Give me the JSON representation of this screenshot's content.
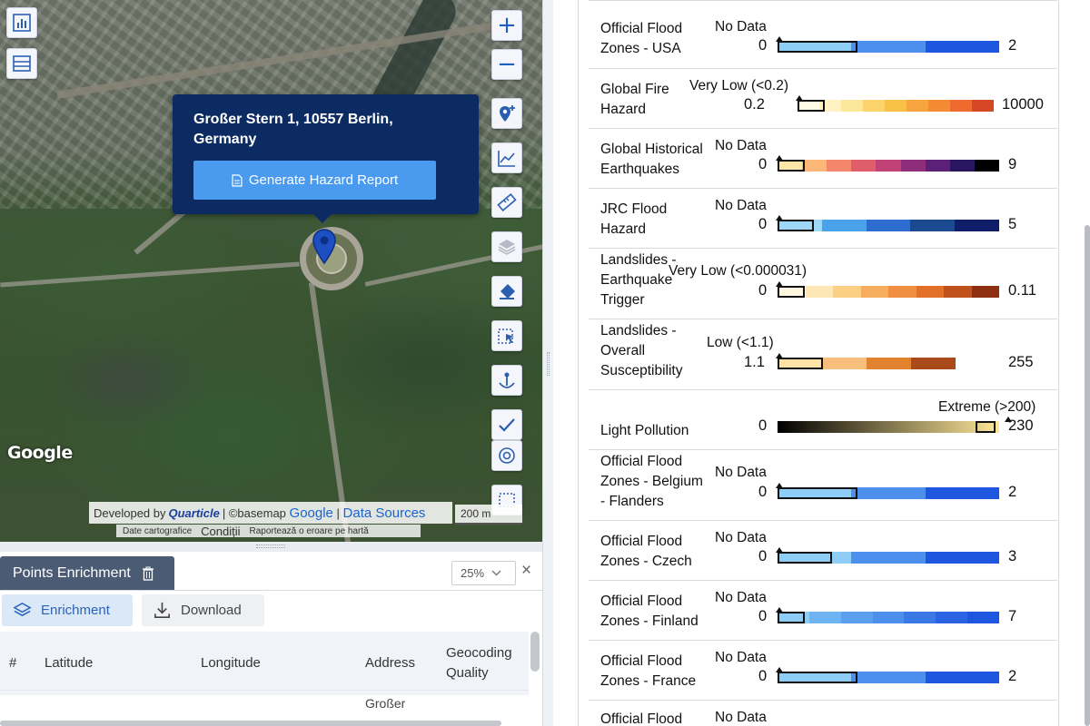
{
  "map": {
    "popup": {
      "address": "Großer Stern 1, 10557 Berlin, Germany",
      "button_label": "Generate Hazard Report"
    },
    "zoom_in": "+",
    "zoom_out": "−",
    "google_logo": "Google",
    "attribution": {
      "developed_by": "Developed by",
      "brand": "Quarticle",
      "basemap": "| ©basemap",
      "google": "Google",
      "sep": "|",
      "data_sources": "Data Sources"
    },
    "scale": "200 m",
    "terms": [
      "Date cartografice",
      "Condiții",
      "Raportează o eroare pe hartă"
    ],
    "tools": [
      "chart-panel-icon",
      "list-panel-icon",
      "add-location-icon",
      "line-chart-icon",
      "ruler-icon",
      "layers-icon",
      "eraser-icon",
      "select-area-icon",
      "anchor-icon",
      "check-icon",
      "target-icon",
      "draw-rect-icon"
    ]
  },
  "bottom_panel": {
    "tab_title": "Points Enrichment",
    "zoom_select": "25%",
    "close": "×",
    "enrichment_label": "Enrichment",
    "download_label": "Download",
    "columns": [
      "#",
      "Latitude",
      "Longitude",
      "Address",
      "Geocoding",
      "Quality"
    ],
    "first_row_address": "Großer"
  },
  "legend": [
    {
      "name": [
        "Official Flood",
        "Zones - USA"
      ],
      "value": "No Data",
      "min": "0",
      "max": "2"
    },
    {
      "name": [
        "Global Fire",
        "Hazard"
      ],
      "value": "Very Low (<0.2)",
      "min": "0.2",
      "max": "10000"
    },
    {
      "name": [
        "Global Historical",
        "Earthquakes"
      ],
      "value": "No Data",
      "min": "0",
      "max": "9"
    },
    {
      "name": [
        "JRC Flood",
        "Hazard"
      ],
      "value": "No Data",
      "min": "0",
      "max": "5"
    },
    {
      "name": [
        "Landslides -",
        "Earthquake",
        "Trigger"
      ],
      "value": "Very Low (<0.000031)",
      "min": "0",
      "max": "0.11"
    },
    {
      "name": [
        "Landslides -",
        "Overall",
        "Susceptibility"
      ],
      "value": "Low (<1.1)",
      "min": "1.1",
      "max": "255"
    },
    {
      "name": [
        "Light Pollution"
      ],
      "value": "Extreme (>200)",
      "min": "0",
      "max": "230"
    },
    {
      "name": [
        "Official Flood",
        "Zones - Belgium",
        "- Flanders"
      ],
      "value": "No Data",
      "min": "0",
      "max": "2"
    },
    {
      "name": [
        "Official Flood",
        "Zones - Czech"
      ],
      "value": "No Data",
      "min": "0",
      "max": "3"
    },
    {
      "name": [
        "Official Flood",
        "Zones - Finland"
      ],
      "value": "No Data",
      "min": "0",
      "max": "7"
    },
    {
      "name": [
        "Official Flood",
        "Zones - France"
      ],
      "value": "No Data",
      "min": "0",
      "max": "2"
    },
    {
      "name": [
        "Official Flood"
      ],
      "value": "No Data",
      "min": "",
      "max": ""
    }
  ],
  "colors": {
    "popup_bg": "#0c2b62",
    "button_blue": "#4a9aef",
    "tab_bg": "#4a5b73",
    "flood_scale": [
      "#8ecdf6",
      "#4c8fec",
      "#1e56e0"
    ],
    "fire_scale": [
      "#fffbe6",
      "#fff3c4",
      "#fde79a",
      "#fbd46b",
      "#f9c046",
      "#f6a43e",
      "#f48a33",
      "#ee6b2d",
      "#d64726"
    ],
    "quake_scale": [
      "#fde7a8",
      "#fcb779",
      "#f4866c",
      "#e05e6c",
      "#c04276",
      "#8e2d7a",
      "#5b2078",
      "#2a1660",
      "#000000"
    ],
    "jrc_scale": [
      "#9fd7f7",
      "#4aa3ea",
      "#2d6dd0",
      "#1c4a90",
      "#101e6a"
    ],
    "slide_eq_scale": [
      "#fff7df",
      "#fde7b5",
      "#fbcf84",
      "#f6ae5e",
      "#ef8f3f",
      "#e27029",
      "#bf511c",
      "#8f2f12"
    ],
    "slide_overall_scale": [
      "#fde3a6",
      "#f7be7c",
      "#e0822e",
      "#a84a1a"
    ],
    "light_scale": [
      "#000000",
      "#ffe89a"
    ]
  }
}
